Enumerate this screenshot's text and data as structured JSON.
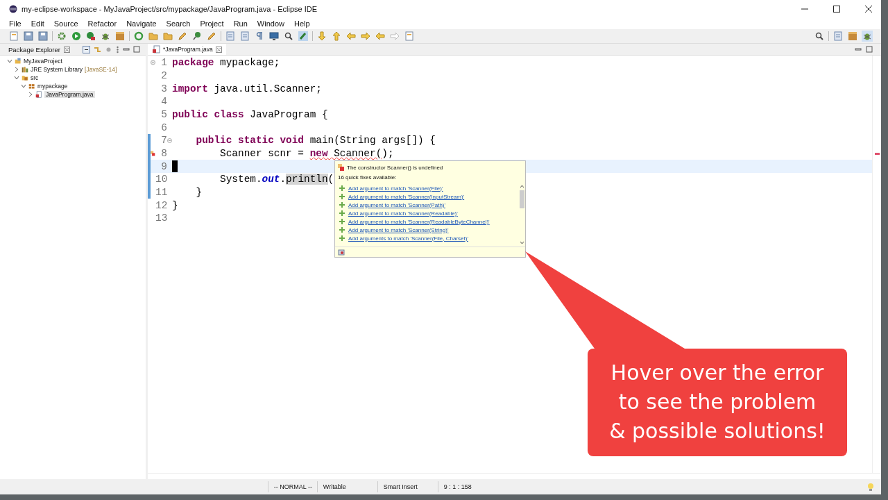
{
  "window": {
    "title": "my-eclipse-workspace - MyJavaProject/src/mypackage/JavaProgram.java - Eclipse IDE"
  },
  "menu": [
    "File",
    "Edit",
    "Source",
    "Refactor",
    "Navigate",
    "Search",
    "Project",
    "Run",
    "Window",
    "Help"
  ],
  "package_explorer": {
    "title": "Package Explorer",
    "tree": [
      {
        "label": "MyJavaProject",
        "kind": "project",
        "expanded": true,
        "selected": false,
        "children": [
          {
            "label": "JRE System Library",
            "decoration": "[JavaSE-14]",
            "kind": "library",
            "expanded": false,
            "selected": false
          },
          {
            "label": "src",
            "kind": "folder",
            "expanded": true,
            "selected": false,
            "children": [
              {
                "label": "mypackage",
                "kind": "package",
                "expanded": true,
                "selected": false,
                "children": [
                  {
                    "label": "JavaProgram.java",
                    "kind": "file",
                    "expanded": false,
                    "selected": true
                  }
                ]
              }
            ]
          }
        ]
      }
    ]
  },
  "editor": {
    "tabs": [
      {
        "label": "*JavaProgram.java",
        "selected": true
      }
    ],
    "lines": [
      {
        "number": "1",
        "fold": {
          "expanded": false
        },
        "error": false,
        "changed": false,
        "current": false,
        "tokens": [
          {
            "text": "package",
            "kind": "keyword"
          },
          {
            "text": " mypackage;",
            "kind": "plain"
          }
        ]
      },
      {
        "number": "2",
        "error": false,
        "changed": false,
        "current": false
      },
      {
        "number": "3",
        "error": false,
        "changed": false,
        "current": false,
        "tokens": [
          {
            "text": "import",
            "kind": "keyword"
          },
          {
            "text": " java.util.Scanner;",
            "kind": "plain"
          }
        ]
      },
      {
        "number": "4",
        "error": false,
        "changed": false,
        "current": false
      },
      {
        "number": "5",
        "error": false,
        "changed": false,
        "current": false,
        "tokens": [
          {
            "text": "public class",
            "kind": "keyword"
          },
          {
            "text": " JavaProgram {",
            "kind": "plain"
          }
        ]
      },
      {
        "number": "6",
        "error": false,
        "changed": false,
        "current": false
      },
      {
        "number": "7",
        "fold": {
          "expanded": true
        },
        "error": false,
        "changed": true,
        "current": false,
        "tokens": [
          {
            "text": "    public static void",
            "kind": "keyword"
          },
          {
            "text": " main(String args[]) {",
            "kind": "plain"
          }
        ]
      },
      {
        "number": "8",
        "error": true,
        "changed": true,
        "current": false,
        "tokens": [
          {
            "text": "        Scanner scnr = ",
            "kind": "plain"
          },
          {
            "text": "new",
            "kind": "errorkeyword"
          },
          {
            "text": " Scanner(",
            "kind": "error"
          },
          {
            "text": ");",
            "kind": "plain"
          }
        ]
      },
      {
        "number": "9",
        "error": false,
        "changed": true,
        "current": true
      },
      {
        "number": "10",
        "error": false,
        "changed": true,
        "current": false,
        "tokens": [
          {
            "text": "        System.",
            "kind": "plain"
          },
          {
            "text": "out",
            "kind": "field"
          },
          {
            "text": ".",
            "kind": "plain"
          },
          {
            "text": "println",
            "kind": "occurrence"
          },
          {
            "text": "(",
            "kind": "plain"
          }
        ]
      },
      {
        "number": "11",
        "error": false,
        "changed": true,
        "current": false,
        "tokens": [
          {
            "text": "    }",
            "kind": "plain"
          }
        ]
      },
      {
        "number": "12",
        "error": false,
        "changed": false,
        "current": false,
        "tokens": [
          {
            "text": "}",
            "kind": "plain"
          }
        ]
      },
      {
        "number": "13",
        "error": false,
        "changed": false,
        "current": false
      }
    ]
  },
  "hover": {
    "message": "The constructor Scanner() is undefined",
    "count_label": "16 quick fixes available:",
    "fixes": [
      "Add argument to match 'Scanner(File)'",
      "Add argument to match 'Scanner(InputStream)'",
      "Add argument to match 'Scanner(Path)'",
      "Add argument to match 'Scanner(Readable)'",
      "Add argument to match 'Scanner(ReadableByteChannel)'",
      "Add argument to match 'Scanner(String)'",
      "Add arguments to match 'Scanner(File, Charset)'"
    ]
  },
  "callout": {
    "lines": [
      "Hover over the error",
      "to see the problem",
      "& possible solutions!"
    ]
  },
  "status_bar": {
    "mode": "-- NORMAL --",
    "writable": "Writable",
    "insert_mode": "Smart Insert",
    "position": "9 : 1 : 158"
  }
}
